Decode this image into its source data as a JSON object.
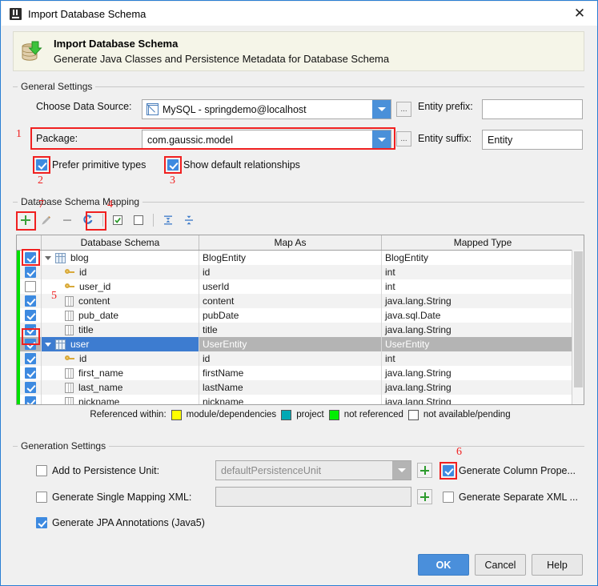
{
  "window": {
    "title": "Import Database Schema",
    "logo_icon": "intellij-idea-icon",
    "close_icon": "close-icon"
  },
  "banner": {
    "icon": "database-import-icon",
    "title": "Import Database Schema",
    "subtitle": "Generate Java Classes and Persistence Metadata for Database Schema"
  },
  "general_settings": {
    "group_label": "General Settings",
    "data_source": {
      "label": "Choose Data Source:",
      "value": "MySQL - springdemo@localhost",
      "icon": "data-source-icon",
      "browse_label": "..."
    },
    "entity_prefix": {
      "label": "Entity prefix:",
      "value": ""
    },
    "package": {
      "label": "Package:",
      "value": "com.gaussic.model",
      "browse_label": "..."
    },
    "entity_suffix": {
      "label": "Entity suffix:",
      "value": "Entity"
    },
    "prefer_primitive_types": {
      "label": "Prefer primitive types",
      "checked": true
    },
    "show_default_relationships": {
      "label": "Show default relationships",
      "checked": true
    }
  },
  "mapping": {
    "group_label": "Database Schema Mapping",
    "toolbar": [
      {
        "name": "add-button",
        "glyph": "+"
      },
      {
        "name": "edit-button",
        "glyph": "pencil"
      },
      {
        "name": "remove-button",
        "glyph": "-"
      },
      {
        "name": "refresh-button",
        "glyph": "refresh"
      },
      {
        "name": "select-all-button",
        "glyph": "checked-box"
      },
      {
        "name": "deselect-all-button",
        "glyph": "empty-box"
      },
      {
        "name": "expand-all-button",
        "glyph": "expand"
      },
      {
        "name": "collapse-all-button",
        "glyph": "collapse"
      }
    ],
    "columns": [
      "",
      "Database Schema",
      "Map As",
      "Mapped Type"
    ],
    "rows": [
      {
        "checked": true,
        "level": 0,
        "icon": "table-icon",
        "name": "blog",
        "map_as": "BlogEntity",
        "mapped_type": "BlogEntity",
        "selected": false
      },
      {
        "checked": true,
        "level": 1,
        "icon": "key-icon",
        "name": "id",
        "map_as": "id",
        "mapped_type": "int",
        "selected": false
      },
      {
        "checked": false,
        "level": 1,
        "icon": "key-icon",
        "name": "user_id",
        "map_as": "userId",
        "mapped_type": "int",
        "selected": false
      },
      {
        "checked": true,
        "level": 1,
        "icon": "column-icon",
        "name": "content",
        "map_as": "content",
        "mapped_type": "java.lang.String",
        "selected": false
      },
      {
        "checked": true,
        "level": 1,
        "icon": "column-icon",
        "name": "pub_date",
        "map_as": "pubDate",
        "mapped_type": "java.sql.Date",
        "selected": false
      },
      {
        "checked": true,
        "level": 1,
        "icon": "column-icon",
        "name": "title",
        "map_as": "title",
        "mapped_type": "java.lang.String",
        "selected": false
      },
      {
        "checked": true,
        "level": 0,
        "icon": "table-icon",
        "name": "user",
        "map_as": "UserEntity",
        "mapped_type": "UserEntity",
        "selected": true
      },
      {
        "checked": true,
        "level": 1,
        "icon": "key-icon",
        "name": "id",
        "map_as": "id",
        "mapped_type": "int",
        "selected": false
      },
      {
        "checked": true,
        "level": 1,
        "icon": "column-icon",
        "name": "first_name",
        "map_as": "firstName",
        "mapped_type": "java.lang.String",
        "selected": false
      },
      {
        "checked": true,
        "level": 1,
        "icon": "column-icon",
        "name": "last_name",
        "map_as": "lastName",
        "mapped_type": "java.lang.String",
        "selected": false
      },
      {
        "checked": true,
        "level": 1,
        "icon": "column-icon",
        "name": "nickname",
        "map_as": "nickname",
        "mapped_type": "java.lang.String",
        "selected": false
      },
      {
        "checked": true,
        "level": 1,
        "icon": "column-icon",
        "name": "",
        "map_as": "",
        "mapped_type": "",
        "selected": false
      }
    ]
  },
  "legend": {
    "prefix": "Referenced within:",
    "items": [
      {
        "label": "module/dependencies",
        "color": "#ffff00"
      },
      {
        "label": "project",
        "color": "#00a9b4"
      },
      {
        "label": "not referenced",
        "color": "#00ef00"
      },
      {
        "label": "not available/pending",
        "color": "#ffffff"
      }
    ]
  },
  "generation_settings": {
    "group_label": "Generation Settings",
    "add_to_persistence_unit": {
      "label": "Add to Persistence Unit:",
      "checked": false,
      "value": "defaultPersistenceUnit"
    },
    "generate_single_mapping_xml": {
      "label": "Generate Single Mapping XML:",
      "checked": false,
      "value": ""
    },
    "generate_jpa_annotations": {
      "label": "Generate JPA Annotations (Java5)",
      "checked": true
    },
    "generate_column_properties": {
      "label": "Generate Column Prope...",
      "checked": true
    },
    "generate_separate_xml": {
      "label": "Generate Separate XML ...",
      "checked": false
    }
  },
  "buttons": {
    "ok": "OK",
    "cancel": "Cancel",
    "help": "Help"
  },
  "annotations": {
    "n1": "1",
    "n2": "2",
    "n3": "3",
    "n4": "4",
    "n5": "5",
    "n6": "6",
    "n7": "7",
    "color": "#f02020"
  }
}
